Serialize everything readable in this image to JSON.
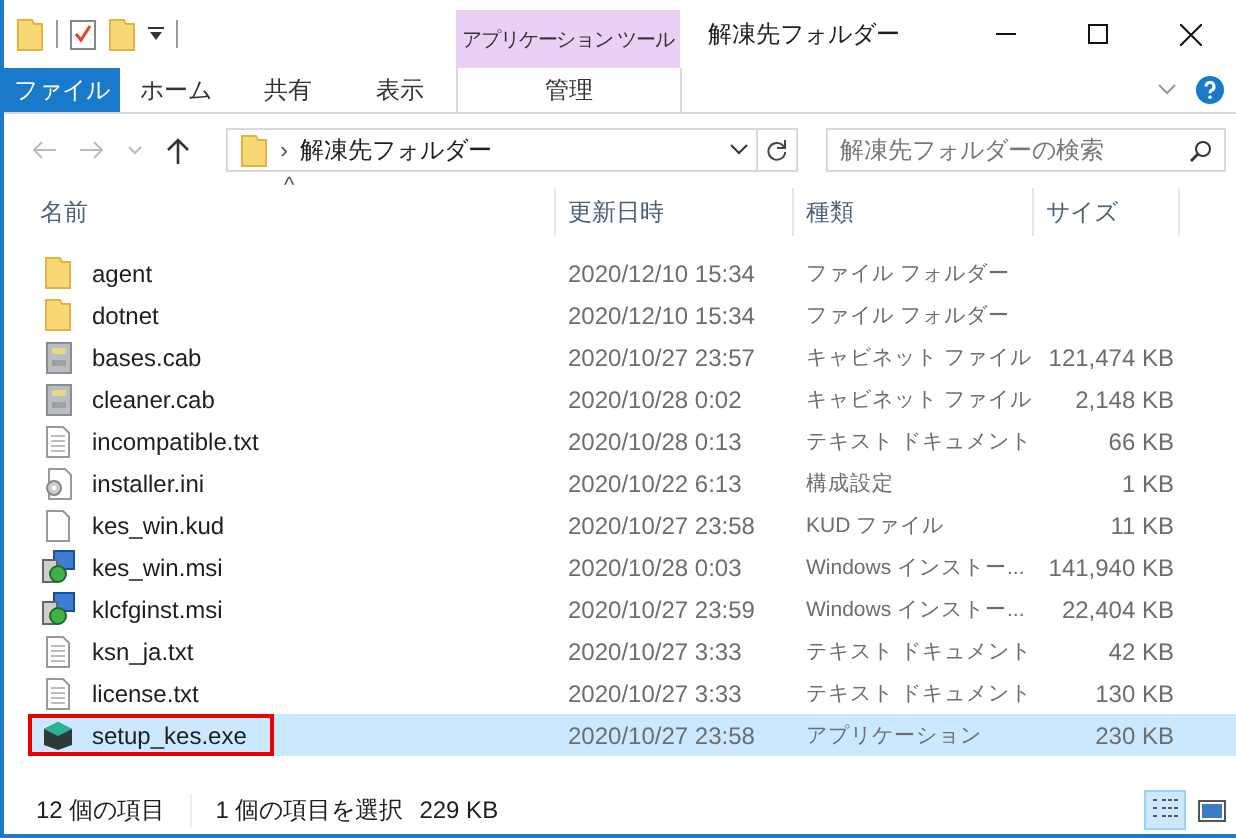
{
  "window": {
    "title": "解凍先フォルダー",
    "context_tab": "アプリケーション ツール"
  },
  "ribbon_tabs": [
    {
      "label": "ファイル",
      "selected": true,
      "kind": "file"
    },
    {
      "label": "ホーム",
      "selected": false,
      "kind": "normal"
    },
    {
      "label": "共有",
      "selected": false,
      "kind": "normal"
    },
    {
      "label": "表示",
      "selected": false,
      "kind": "normal"
    },
    {
      "label": "管理",
      "selected": false,
      "kind": "context"
    }
  ],
  "address": {
    "separator": "›",
    "path": "解凍先フォルダー"
  },
  "search": {
    "placeholder": "解凍先フォルダーの検索"
  },
  "sort_indicator": "^",
  "columns": [
    "名前",
    "更新日時",
    "種類",
    "サイズ"
  ],
  "files": [
    {
      "name": "agent",
      "modified": "2020/12/10 15:34",
      "type": "ファイル フォルダー",
      "kind": "folder",
      "selected": false,
      "outlined": false
    },
    {
      "name": "dotnet",
      "modified": "2020/12/10 15:34",
      "type": "ファイル フォルダー",
      "kind": "folder",
      "selected": false,
      "outlined": false
    },
    {
      "name": "bases.cab",
      "modified": "2020/10/27 23:57",
      "type": "キャビネット ファイル",
      "size": "121,474 KB",
      "kind": "cab",
      "selected": false,
      "outlined": false
    },
    {
      "name": "cleaner.cab",
      "modified": "2020/10/28 0:02",
      "type": "キャビネット ファイル",
      "size": "2,148 KB",
      "kind": "cab",
      "selected": false,
      "outlined": false
    },
    {
      "name": "incompatible.txt",
      "modified": "2020/10/28 0:13",
      "type": "テキスト ドキュメント",
      "size": "66 KB",
      "kind": "text",
      "selected": false,
      "outlined": false
    },
    {
      "name": "installer.ini",
      "modified": "2020/10/22 6:13",
      "type": "構成設定",
      "size": "1 KB",
      "kind": "settings",
      "selected": false,
      "outlined": false
    },
    {
      "name": "kes_win.kud",
      "modified": "2020/10/27 23:58",
      "type": "KUD ファイル",
      "size": "11 KB",
      "kind": "blank",
      "selected": false,
      "outlined": false
    },
    {
      "name": "kes_win.msi",
      "modified": "2020/10/28 0:03",
      "type": "Windows インストー...",
      "size": "141,940 KB",
      "kind": "installer",
      "selected": false,
      "outlined": false
    },
    {
      "name": "klcfginst.msi",
      "modified": "2020/10/27 23:59",
      "type": "Windows インストー...",
      "size": "22,404 KB",
      "kind": "installer",
      "selected": false,
      "outlined": false
    },
    {
      "name": "ksn_ja.txt",
      "modified": "2020/10/27 3:33",
      "type": "テキスト ドキュメント",
      "size": "42 KB",
      "kind": "text",
      "selected": false,
      "outlined": false
    },
    {
      "name": "license.txt",
      "modified": "2020/10/27 3:33",
      "type": "テキスト ドキュメント",
      "size": "130 KB",
      "kind": "text",
      "selected": false,
      "outlined": false
    },
    {
      "name": "setup_kes.exe",
      "modified": "2020/10/27 23:58",
      "type": "アプリケーション",
      "size": "230 KB",
      "kind": "app",
      "selected": true,
      "outlined": true
    }
  ],
  "status_bar": {
    "count": "12 個の項目",
    "selection": "1 個の項目を選択",
    "selection_size": "229 KB",
    "views": [
      {
        "kind": "details",
        "selected": true
      },
      {
        "kind": "large",
        "selected": false
      }
    ]
  }
}
